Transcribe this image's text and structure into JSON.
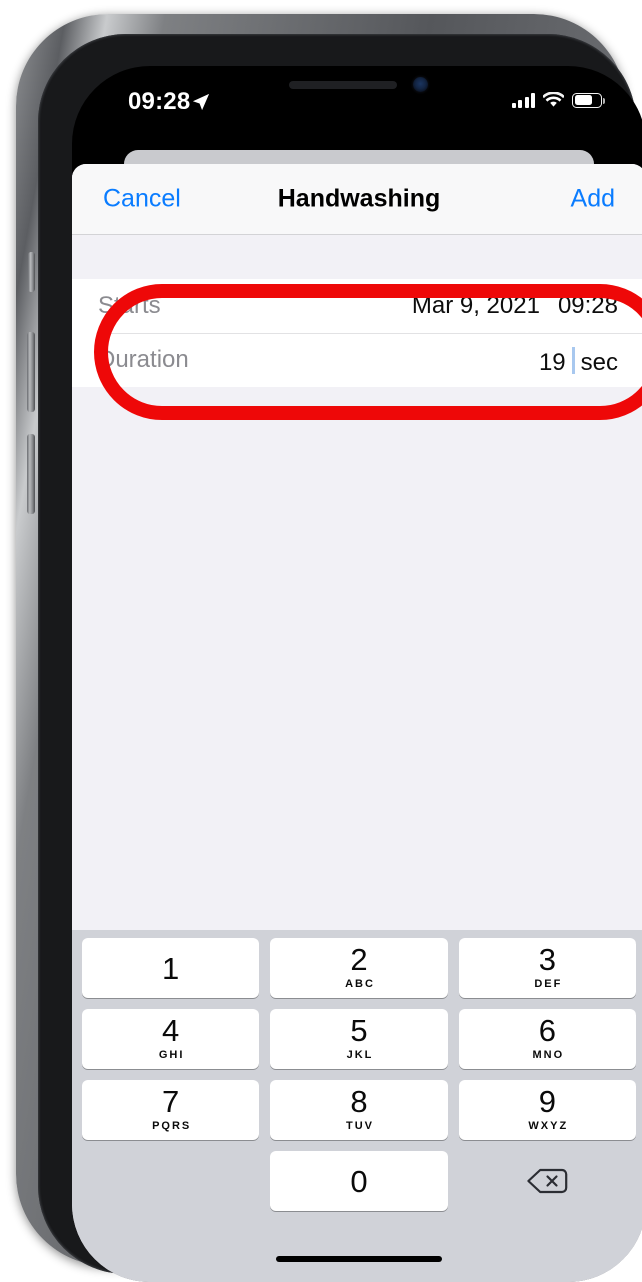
{
  "status_bar": {
    "time": "09:28",
    "location_icon": "location-arrow-icon",
    "cellular_icon": "cellular-bars-icon",
    "wifi_icon": "wifi-icon",
    "battery_icon": "battery-icon"
  },
  "nav": {
    "cancel_label": "Cancel",
    "title": "Handwashing",
    "add_label": "Add"
  },
  "form": {
    "rows": [
      {
        "label": "Starts",
        "date_value": "Mar 9, 2021",
        "time_value": "09:28"
      },
      {
        "label": "Duration",
        "number_value": "19",
        "unit_value": "sec"
      }
    ]
  },
  "keyboard": {
    "keys": [
      {
        "digit": "1",
        "letters": ""
      },
      {
        "digit": "2",
        "letters": "ABC"
      },
      {
        "digit": "3",
        "letters": "DEF"
      },
      {
        "digit": "4",
        "letters": "GHI"
      },
      {
        "digit": "5",
        "letters": "JKL"
      },
      {
        "digit": "6",
        "letters": "MNO"
      },
      {
        "digit": "7",
        "letters": "PQRS"
      },
      {
        "digit": "8",
        "letters": "TUV"
      },
      {
        "digit": "9",
        "letters": "WXYZ"
      },
      {
        "digit": "0",
        "letters": ""
      }
    ],
    "delete_icon": "backspace-delete-icon"
  },
  "annotation": {
    "shape": "rounded-rectangle-highlight",
    "color": "#ee0808"
  },
  "colors": {
    "accent_blue": "#0a7cff",
    "sheet_background": "#f2f1f6",
    "row_background": "#ffffff",
    "keyboard_background": "#d0d2d8",
    "label_gray": "#8b8b90",
    "caret_blue": "#a8c8ef"
  }
}
